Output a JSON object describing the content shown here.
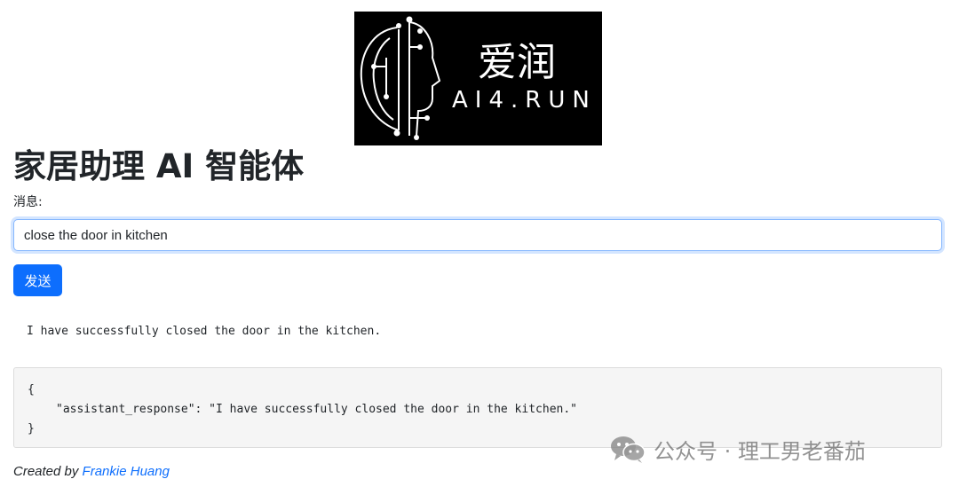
{
  "logo": {
    "cn_text": "爱润",
    "en_text": "AI4.RUN"
  },
  "title": "家居助理 AI 智能体",
  "form": {
    "label": "消息:",
    "input_value": "close the door in kitchen",
    "send_label": "发送"
  },
  "response_text": "I have successfully closed the door in the kitchen.",
  "json_output": {
    "open_brace": "{",
    "line": "\"assistant_response\": \"I have successfully closed the door in the kitchen.\"",
    "close_brace": "}"
  },
  "footer": {
    "prefix": "Created by ",
    "author": "Frankie Huang"
  },
  "watermark": {
    "text": "公众号 · 理工男老番茄"
  },
  "colors": {
    "primary": "#0d6efd",
    "logo_bg": "#000000"
  }
}
